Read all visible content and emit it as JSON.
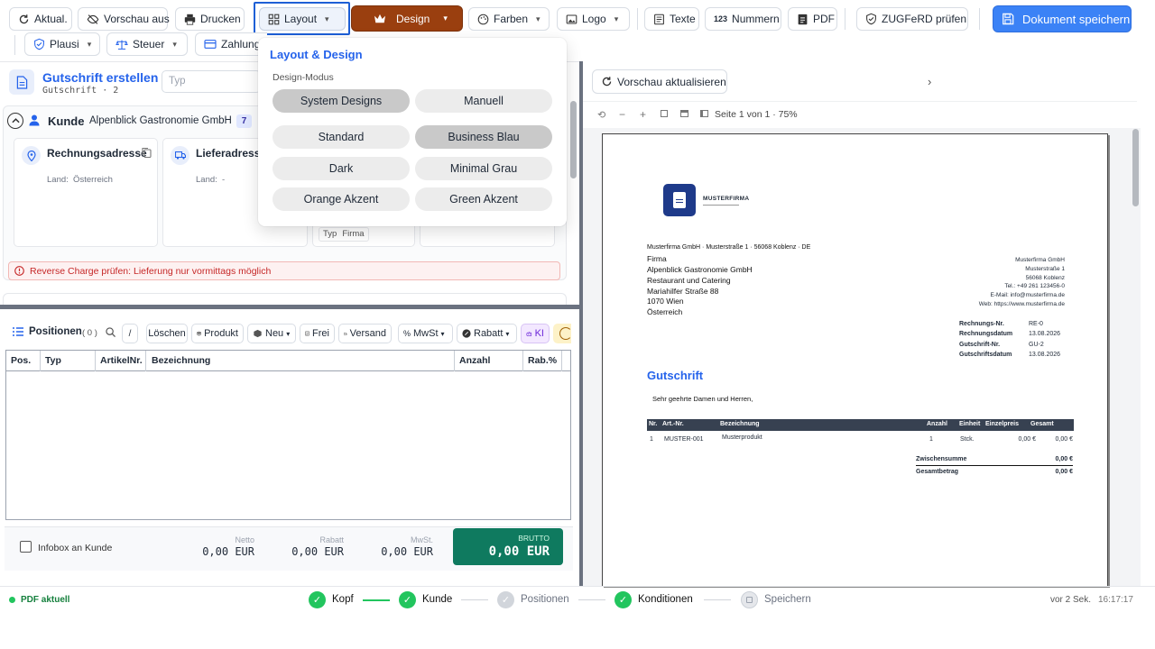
{
  "toolbar": {
    "refresh": "Aktual.",
    "preview_off": "Vorschau aus",
    "print": "Drucken",
    "layout": "Layout",
    "design": "Design",
    "colors": "Farben",
    "logo": "Logo",
    "texts": "Texte",
    "numbers": "Nummern",
    "pdf": "PDF",
    "zugferd": "ZUGFeRD prüfen",
    "save": "Dokument speichern",
    "plausi": "Plausi",
    "tax": "Steuer",
    "payment": "Zahlung"
  },
  "layout_popup": {
    "title": "Layout & Design",
    "mode_label": "Design-Modus",
    "modes": [
      "System Designs",
      "Manuell"
    ],
    "designs": [
      "Standard",
      "Business Blau",
      "Dark",
      "Minimal Grau",
      "Orange Akzent",
      "Green Akzent"
    ]
  },
  "doc": {
    "title": "Gutschrift erstellen",
    "subtitle": "Gutschrift · 2",
    "type_placeholder": "Typ"
  },
  "customer": {
    "section_label": "Kunde",
    "name": "Alpenblick Gastronomie GmbH",
    "badge": "7",
    "billing_label": "Rechnungsadresse",
    "billing_country": "Land:  Österreich",
    "delivery_label": "Lieferadresse",
    "delivery_country": "Land:  -",
    "type_label": "Typ",
    "type_value": "Firma"
  },
  "warning": "Reverse Charge prüfen: Lieferung nur vormittags möglich",
  "positions": {
    "label": "Positionen",
    "count": "( 0 )",
    "slash": "/",
    "delete": "Löschen",
    "product": "Produkt",
    "new": "Neu",
    "free": "Frei",
    "shipping": "Versand",
    "vat": "MwSt",
    "discount": "Rabatt",
    "ai": "KI",
    "columns": [
      "Pos.",
      "Typ",
      "ArtikelNr.",
      "Bezeichnung",
      "Anzahl",
      "Rab.%"
    ]
  },
  "totals": {
    "infobox": "Infobox an Kunde",
    "net_label": "Netto",
    "net_value": "0,00 EUR",
    "discount_label": "Rabatt",
    "discount_value": "0,00 EUR",
    "vat_label": "MwSt.",
    "vat_value": "0,00 EUR",
    "gross_label": "BRUTTO",
    "gross_value": "0,00 EUR"
  },
  "preview": {
    "refresh": "Vorschau aktualisieren",
    "page_info": "Seite 1 von 1 · 75%"
  },
  "pdf": {
    "company_logo": "MUSTERFIRMA",
    "sender_line": "Musterfirma GmbH · Musterstraße 1 · 56068 Koblenz · DE",
    "recipient": [
      "Firma",
      "Alpenblick Gastronomie GmbH",
      "Restaurant und Catering",
      "Mariahilfer Straße 88",
      "1070 Wien",
      "Österreich"
    ],
    "company_info": [
      "Musterfirma GmbH",
      "Musterstraße 1",
      "56068 Koblenz",
      "Tel.: +49 261 123456-0",
      "E-Mail: info@musterfirma.de",
      "Web: https://www.musterfirma.de"
    ],
    "meta": [
      {
        "label": "Rechnungs-Nr.",
        "value": "RE-0"
      },
      {
        "label": "Rechnungsdatum",
        "value": "13.08.2026"
      },
      {
        "label": "Gutschrift-Nr.",
        "value": "GU-2"
      },
      {
        "label": "Gutschriftsdatum",
        "value": "13.08.2026"
      }
    ],
    "heading": "Gutschrift",
    "greeting": "Sehr geehrte Damen und Herren,",
    "table_headers": [
      "Nr.",
      "Art.-Nr.",
      "Bezeichnung",
      "Anzahl",
      "Einheit",
      "Einzelpreis",
      "Gesamt"
    ],
    "row": [
      "1",
      "MUSTER-001",
      "Musterprodukt",
      "1",
      "Stck.",
      "0,00 €",
      "0,00 €"
    ],
    "subtotal_label": "Zwischensumme",
    "subtotal_value": "0,00 €",
    "total_label": "Gesamtbetrag",
    "total_value": "0,00 €"
  },
  "status": {
    "pdf_state": "PDF aktuell",
    "steps": [
      "Kopf",
      "Kunde",
      "Positionen",
      "Konditionen",
      "Speichern"
    ],
    "time_ago": "vor 2 Sek.",
    "time": "16:17:17"
  },
  "colors": {
    "primary": "#3b82f6",
    "design_button": "#9a3f0f",
    "brutto": "#0f7a5f",
    "heading_blue": "#2563eb",
    "warning_red": "#c62828",
    "success_green": "#22c55e"
  }
}
